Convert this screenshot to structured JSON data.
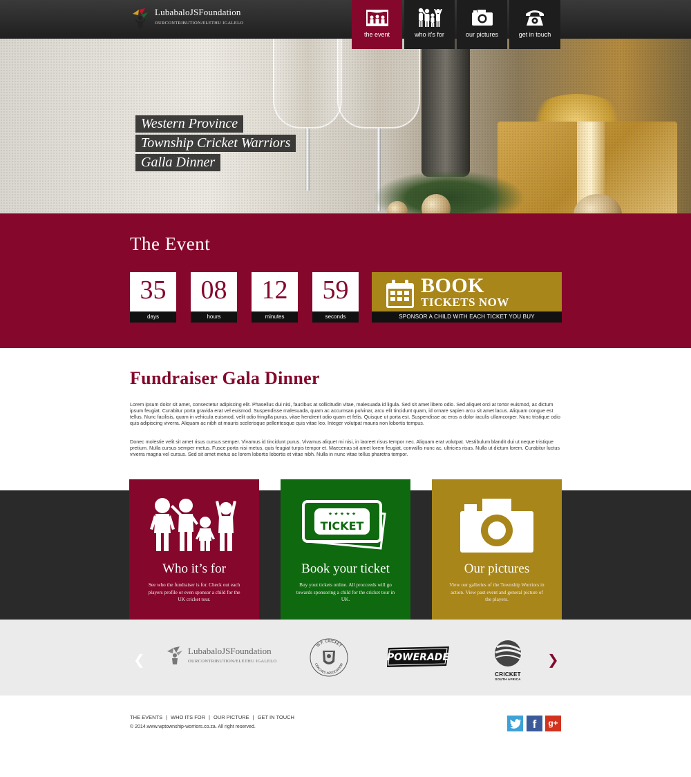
{
  "header": {
    "logo_name": "LubabaloJSFoundation",
    "logo_tagline": "OURCONTRIBUTION/ELETHU IGALELO",
    "nav": [
      {
        "label": "the event",
        "icon": "theatre-icon",
        "active": true
      },
      {
        "label": "who it's for",
        "icon": "kids-icon",
        "active": false
      },
      {
        "label": "our pictures",
        "icon": "camera-icon",
        "active": false
      },
      {
        "label": "get in touch",
        "icon": "telephone-icon",
        "active": false
      }
    ]
  },
  "hero": {
    "lines": [
      "Western Province",
      "Township Cricket Warriors",
      "Galla Dinner"
    ]
  },
  "event": {
    "title": "The Event",
    "countdown": [
      {
        "value": "35",
        "label": "days"
      },
      {
        "value": "08",
        "label": "hours"
      },
      {
        "value": "12",
        "label": "minutes"
      },
      {
        "value": "59",
        "label": "seconds"
      }
    ],
    "book_line1": "BOOK",
    "book_line2": "TICKETS NOW",
    "book_strip": "SPONSOR A CHILD WITH EACH TICKET YOU BUY"
  },
  "content": {
    "title": "Fundraiser Gala Dinner",
    "paragraph1": "Lorem ipsum dolor sit amet, consectetur adipiscing elit. Phasellus dui nisi, faucibus at sollicitudin vitae, malesuada id ligula. Sed sit amet libero odio. Sed aliquet orci at tortor euismod, ac dictum ipsum feugiat. Curabitur porta gravida erat vel euismod. Suspendisse malesuada, quam ac accumsan pulvinar, arcu elit tincidunt quam, id ornare sapien arcu sit amet lacus. Aliquam congue est tellus. Nunc facilisis, quam in vehicula euismod, velit odio fringilla purus, vitae hendrerit odio quam et felis. Quisque ut porta est. Suspendisse ac eros a dolor iaculis ullamcorper. Nunc tristique odio quis adipiscing viverra. Aliquam ac nibh at mauris scelerisque pellentesque quis vitae leo. Integer volutpat mauris non lobortis tempus.",
    "paragraph2": "Donec molestie velit sit amet risus cursus semper. Vivamus id tincidunt purus. Vivamus aliquet mi nisi, in laoreet risus tempor nec. Aliquam erat volutpat. Vestibulum blandit dui ut neque tristique pretium. Nulla cursus semper metus. Fusce porta nisi metus, quis feugiat turpis tempor et. Maecenas sit amet lorem feugiat, convallis nunc ac, ultricies risus. Nulla ut dictum lorem. Curabitur luctus viverra magna vel cursus. Sed sit amet metus ac lorem lobortis lobortis et vitae nibh. Nulla in nunc vitae tellus pharetra tempor."
  },
  "cards": [
    {
      "title": "Who it’s for",
      "text": "See who the fundraiser is for. Check out each players profile or even sponsor a child for the UK cricket tour.",
      "icon": "kids-icon",
      "color": "#85072c"
    },
    {
      "title": "Book your ticket",
      "text": "Buy yout tickets online. All procceeds will go towards sponsoring a child for the cricket tour in UK.",
      "icon": "ticket-icon",
      "ticket_word": "TICKET",
      "color": "#0f6a0f"
    },
    {
      "title": "Our pictures",
      "text": "View our galleries of the Township Worriors in action. View past event and general picture of the players.",
      "icon": "camera-icon",
      "color": "#a8861a"
    }
  ],
  "sponsors": {
    "logo1_name": "LubabaloJSFoundation",
    "logo1_tagline": "OURCONTRIBUTION/ELETHU IGALELO",
    "logo2_top": "W.P. CRICKET",
    "logo2_bottom": "COACHES ASSOCIATION",
    "logo3": "POWERADE",
    "logo4_name": "CRICKET",
    "logo4_sub": "SOUTH AFRICA"
  },
  "footer": {
    "links": [
      "THE EVENTS",
      "WHO ITS FOR",
      "OUR PICTURE",
      "GET IN TOUCH"
    ],
    "separator": "|",
    "copyright": "© 2014.www.wptownship-worriors.co.za. All right reserved.",
    "social": [
      "twitter-icon",
      "facebook-icon",
      "google-plus-icon"
    ],
    "social_glyphs": {
      "twitter": "t",
      "facebook": "f",
      "google_plus": "g+"
    }
  },
  "colors": {
    "brand_red": "#85072c",
    "brand_green": "#0f6a0f",
    "brand_gold": "#a8861a",
    "dark": "#2a2a2a"
  }
}
